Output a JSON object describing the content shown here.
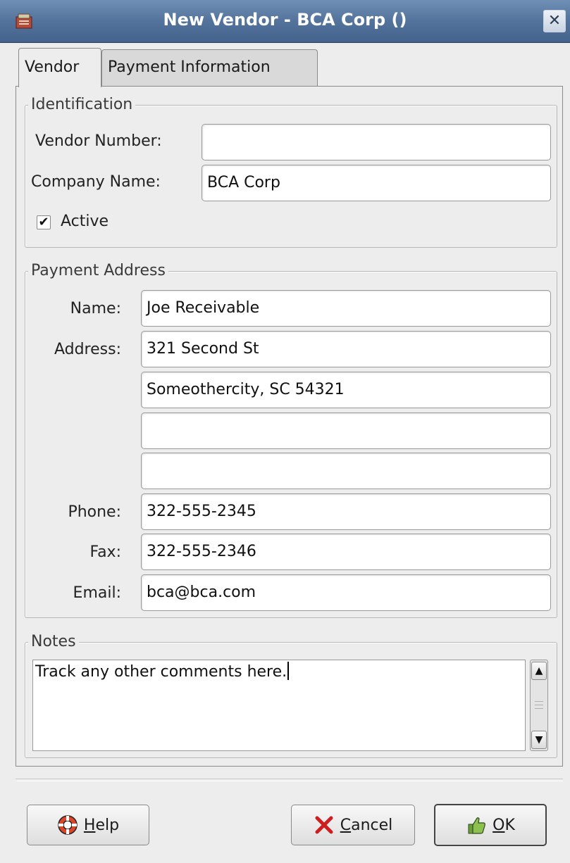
{
  "window": {
    "title": "New Vendor - BCA Corp ()",
    "close_glyph": "✕"
  },
  "tabs": [
    {
      "label": "Vendor",
      "active": true
    },
    {
      "label": "Payment Information",
      "active": false
    }
  ],
  "identification": {
    "legend": "Identification",
    "vendor_number_label": "Vendor Number:",
    "vendor_number_value": "",
    "company_name_label": "Company Name:",
    "company_name_value": "BCA Corp",
    "active_label": "Active",
    "active_checked": true,
    "check_glyph": "✔"
  },
  "payment_address": {
    "legend": "Payment Address",
    "name_label": "Name:",
    "name_value": "Joe Receivable",
    "address_label": "Address:",
    "address_lines": [
      "321 Second St",
      "Someothercity, SC 54321",
      "",
      ""
    ],
    "phone_label": "Phone:",
    "phone_value": "322-555-2345",
    "fax_label": "Fax:",
    "fax_value": "322-555-2346",
    "email_label": "Email:",
    "email_value": "bca@bca.com"
  },
  "notes": {
    "legend": "Notes",
    "text": "Track any other comments here."
  },
  "buttons": {
    "help_mnemonic": "H",
    "help_rest": "elp",
    "cancel_mnemonic": "C",
    "cancel_rest": "ancel",
    "ok_mnemonic": "O",
    "ok_rest": "K"
  },
  "icons": {
    "window_icon": "vendor-app-icon",
    "help_icon": "lifebuoy-icon",
    "cancel_icon": "red-x-icon",
    "ok_icon": "thumbs-up-icon"
  },
  "colors": {
    "titlebar": "#53739c",
    "cancel_x": "#cc1f1f",
    "ok_icon": "#6b9e3a",
    "help_icon": "#d9472b"
  }
}
